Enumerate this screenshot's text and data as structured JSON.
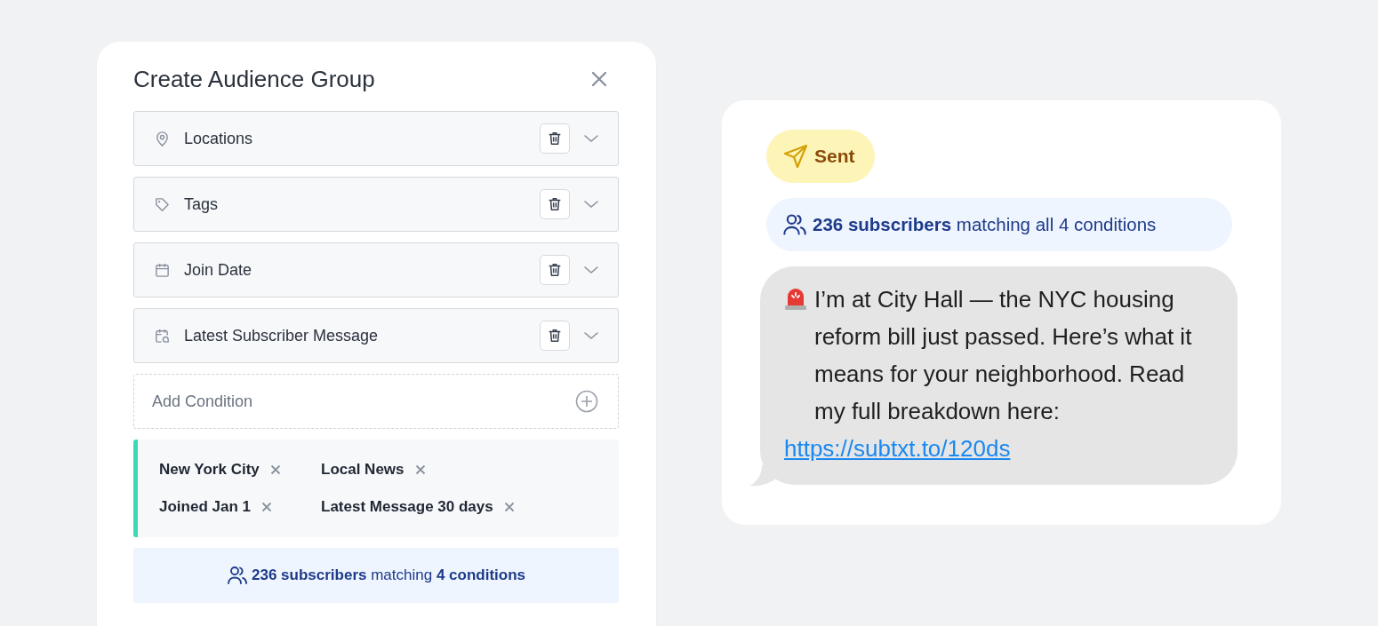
{
  "dialog": {
    "title": "Create Audience Group",
    "conditions": [
      {
        "kind": "location",
        "label": "Locations",
        "expanded": false
      },
      {
        "kind": "tag",
        "label": "Tags",
        "expanded": false
      },
      {
        "kind": "date",
        "label": "Join Date",
        "expanded": false
      },
      {
        "kind": "message",
        "label": "Latest Subscriber Message",
        "expanded": false
      }
    ],
    "add_condition": {
      "label": "Add Condition"
    },
    "filters": [
      {
        "label": "New York City"
      },
      {
        "label": "Local News"
      },
      {
        "label": "Joined Jan 1"
      },
      {
        "label": "Latest Message 30 days"
      }
    ],
    "summary": "**236 subscribers** matching **4 conditions**"
  },
  "preview": {
    "status": {
      "kind": "sent",
      "label": "Sent"
    },
    "summary": "**236 subscribers** matching all 4 conditions",
    "message": {
      "text": "I’m at City Hall — the NYC housing reform bill just passed. Here’s what it means for your neighborhood. Read my full breakdown here:",
      "link": "https://subtxt.to/120ds"
    }
  }
}
